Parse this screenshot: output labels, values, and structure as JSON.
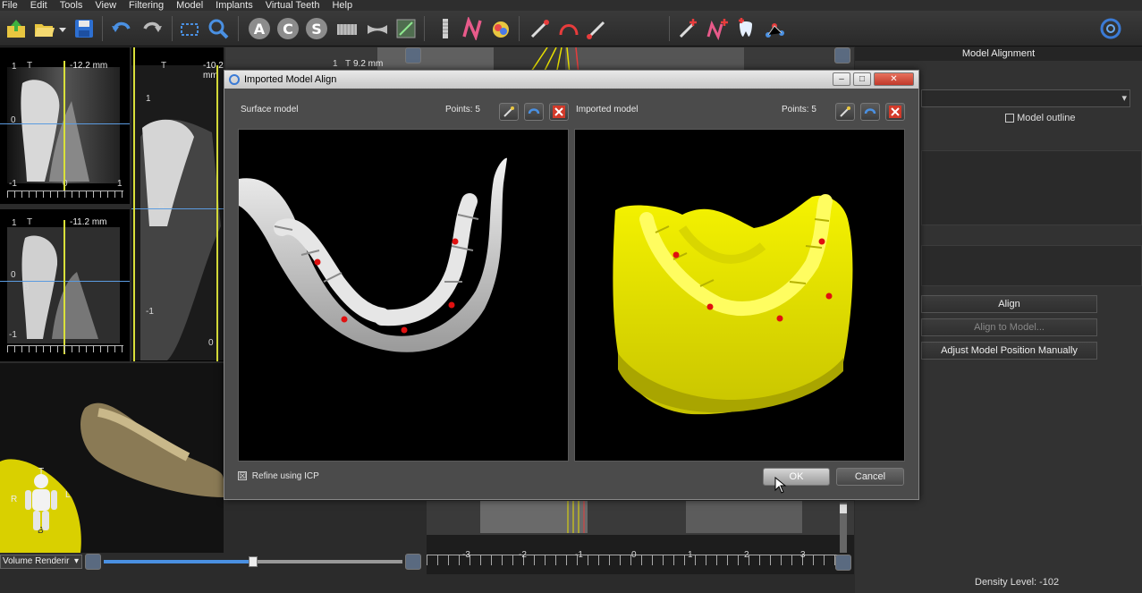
{
  "menu": [
    "File",
    "Edit",
    "Tools",
    "View",
    "Filtering",
    "Model",
    "Implants",
    "Virtual Teeth",
    "Help"
  ],
  "toolbar": {
    "letters": [
      "A",
      "C",
      "S"
    ]
  },
  "viewports": {
    "slice1_mm": "-12.2 mm",
    "slice2_mm": "-10.2 mm",
    "slice3_mm": "9.2 mm",
    "slice4_mm": "-11.2 mm",
    "t_label": "T",
    "b_label": "B",
    "one": "1",
    "zero": "0",
    "neg1": "-1",
    "bottom_scale": [
      "-3",
      "-2",
      "-1",
      "0",
      "1",
      "2",
      "3"
    ],
    "orient": {
      "t": "T",
      "r": "R",
      "l": "L",
      "b": "B"
    },
    "render_mode": "Volume Renderir",
    "slider_value": 0.5
  },
  "right_panel": {
    "title": "Model Alignment",
    "model_outline_label": "Model outline",
    "align_label": "Align",
    "align_to_model_label": "Align to Model...",
    "adjust_label": "Adjust Model Position Manually"
  },
  "dialog": {
    "title": "Imported Model Align",
    "left_pane_title": "Surface model",
    "left_points": "Points: 5",
    "right_pane_title": "Imported model",
    "right_points": "Points: 5",
    "refine_label": "Refine using ICP",
    "refine_checked": "☒",
    "ok_label": "OK",
    "cancel_label": "Cancel"
  },
  "status": {
    "density": "Density Level: -102"
  },
  "colors": {
    "yellow_line": "#d9e03a",
    "blue_line": "#5b9be0",
    "model_yellow": "#e8e600",
    "point_red": "#e01010"
  }
}
